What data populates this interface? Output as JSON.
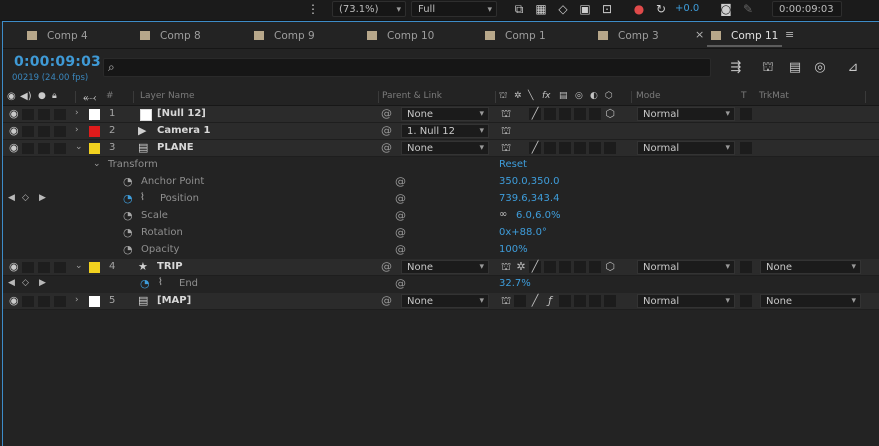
{
  "viewer": {
    "zoom": "(73.1%)",
    "resolution": "Full",
    "exposure": "+0.0",
    "timecode": "0:00:09:03"
  },
  "tabs": [
    {
      "label": "Comp 4"
    },
    {
      "label": "Comp 8"
    },
    {
      "label": "Comp 9"
    },
    {
      "label": "Comp 10"
    },
    {
      "label": "Comp 1"
    },
    {
      "label": "Comp 3"
    },
    {
      "label": "Comp 11",
      "active": true
    }
  ],
  "timeline": {
    "timecode": "0:00:09:03",
    "frame_info": "00219 (24.00 fps)",
    "search_placeholder": ""
  },
  "columns": {
    "number": "#",
    "layer_name": "Layer Name",
    "parent_link": "Parent & Link",
    "mode": "Mode",
    "t": "T",
    "trkmat": "TrkMat",
    "fx": "fx"
  },
  "colors": {
    "accent": "#3e9ddb",
    "label_red": "#e01b1b",
    "label_yellow": "#f2d21f",
    "label_white": "#ffffff"
  },
  "layers": [
    {
      "num": "1",
      "name": "[Null 12]",
      "label_color": "#ffffff",
      "parent": "None",
      "mode": "Normal",
      "icon": "null-icon"
    },
    {
      "num": "2",
      "name": "Camera 1",
      "label_color": "#e01b1b",
      "parent": "1. Null 12",
      "icon": "camera-icon"
    },
    {
      "num": "3",
      "name": "PLANE",
      "label_color": "#f2d21f",
      "parent": "None",
      "mode": "Normal",
      "icon": "file-icon"
    },
    {
      "num": "4",
      "name": "TRIP",
      "label_color": "#f2d21f",
      "parent": "None",
      "mode": "Normal",
      "trkmat": "None",
      "icon": "star-icon"
    },
    {
      "num": "5",
      "name": "[MAP]",
      "label_color": "#ffffff",
      "parent": "None",
      "mode": "Normal",
      "trkmat": "None",
      "icon": "file-icon"
    }
  ],
  "transform": {
    "group_label": "Transform",
    "reset_label": "Reset",
    "props": [
      {
        "name": "Anchor Point",
        "value": "350.0,350.0"
      },
      {
        "name": "Position",
        "value": "739.6,343.4"
      },
      {
        "name": "Scale",
        "value": "6.0,6.0%"
      },
      {
        "name": "Rotation",
        "value": "0x+88.0°"
      },
      {
        "name": "Opacity",
        "value": "100%"
      }
    ]
  },
  "trip_prop": {
    "name": "End",
    "value": "32.7%"
  }
}
